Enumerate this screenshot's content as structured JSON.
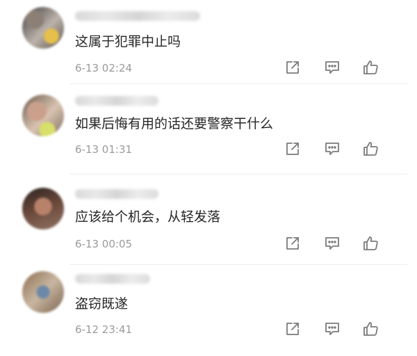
{
  "comments": [
    {
      "text": "这属于犯罪中止吗",
      "time": "6-13 02:24"
    },
    {
      "text": "如果后悔有用的话还要警察干什么",
      "time": "6-13 01:31"
    },
    {
      "text": "应该给个机会，从轻发落",
      "time": "6-13 00:05"
    },
    {
      "text": "盗窃既遂",
      "time": "6-12 23:41"
    }
  ],
  "icons": {
    "share": "share-icon",
    "reply": "reply-icon",
    "like": "like-icon"
  },
  "colors": {
    "text": "#262626",
    "meta": "#9a9a9a",
    "icon": "#7a7a7a"
  }
}
